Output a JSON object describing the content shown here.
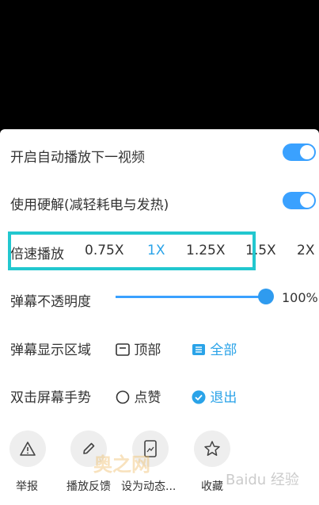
{
  "settings": {
    "autoplay_label": "开启自动播放下一视频",
    "hw_decode_label": "使用硬解(减轻耗电与发热)",
    "speed_label": "倍速播放",
    "speed_options": [
      "0.75X",
      "1X",
      "1.25X",
      "1.5X",
      "2X"
    ],
    "opacity_label": "弹幕不透明度",
    "opacity_value": "100%",
    "opacity_level": 1.0,
    "area_label": "弹幕显示区域",
    "area_top": "顶部",
    "area_all": "全部",
    "gesture_label": "双击屏幕手势",
    "gesture_like": "点赞",
    "gesture_exit": "退出"
  },
  "bottom_actions": {
    "report": "举报",
    "feedback": "播放反馈",
    "set_wallpaper": "设为动态...",
    "favorite": "收藏"
  },
  "watermark": {
    "site": "奥之网",
    "baidu": "Baidu 经验"
  },
  "colors": {
    "accent": "#2aa3e8",
    "highlight": "#22c7cf"
  }
}
